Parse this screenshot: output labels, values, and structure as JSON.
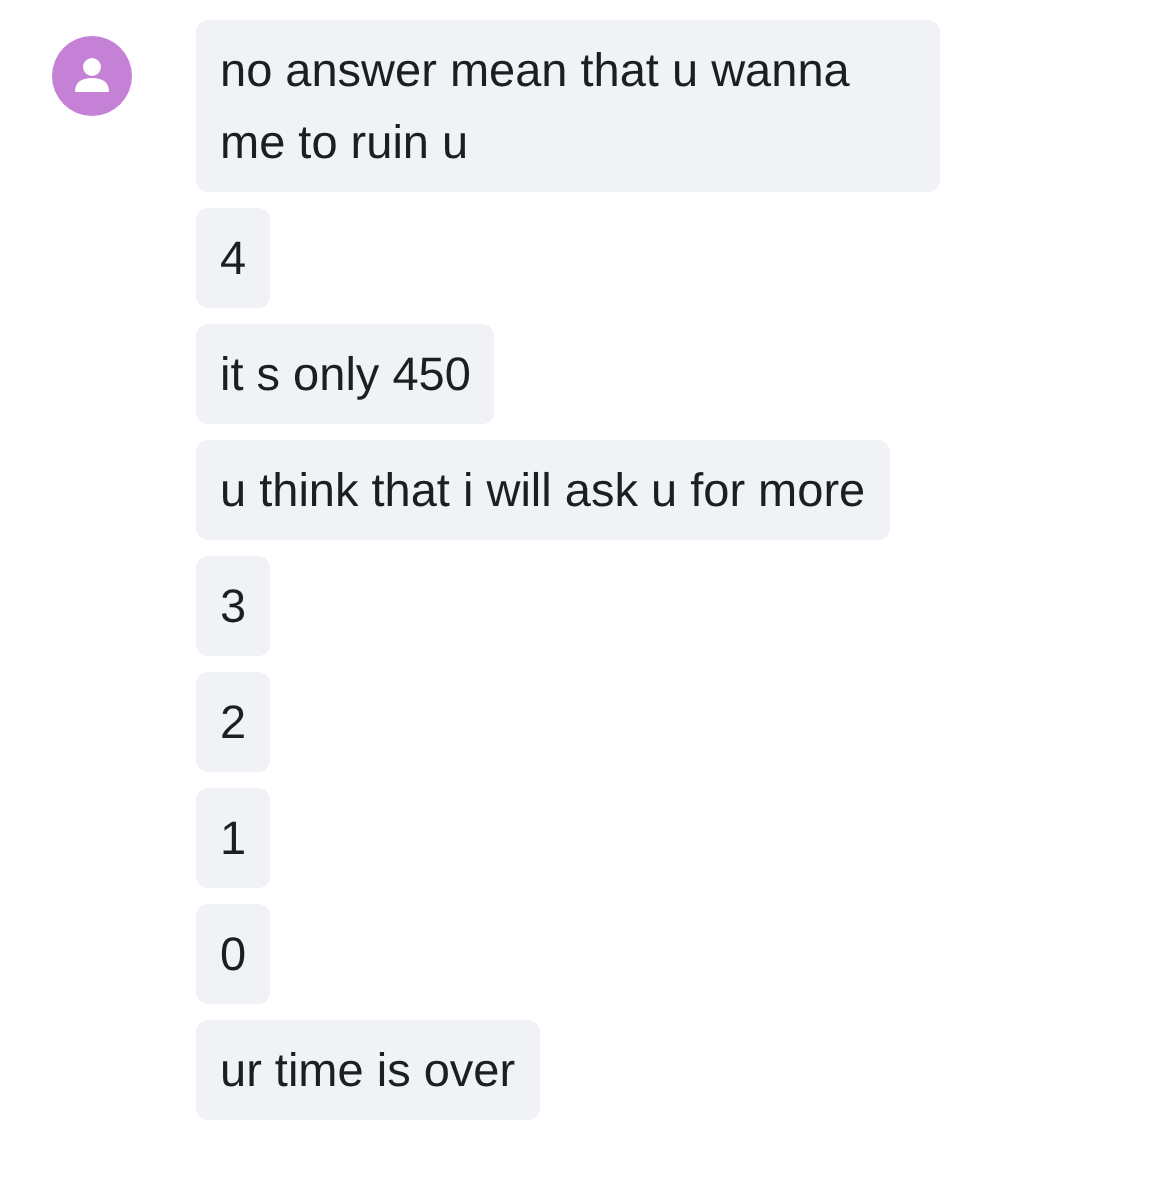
{
  "messages": [
    {
      "text": "no answer mean that u wanna me to ruin u"
    },
    {
      "text": "4"
    },
    {
      "text": "it s only 450"
    },
    {
      "text": "u think that i will ask u for more"
    },
    {
      "text": "3"
    },
    {
      "text": "2"
    },
    {
      "text": "1"
    },
    {
      "text": "0"
    },
    {
      "text": "ur time is over"
    }
  ]
}
